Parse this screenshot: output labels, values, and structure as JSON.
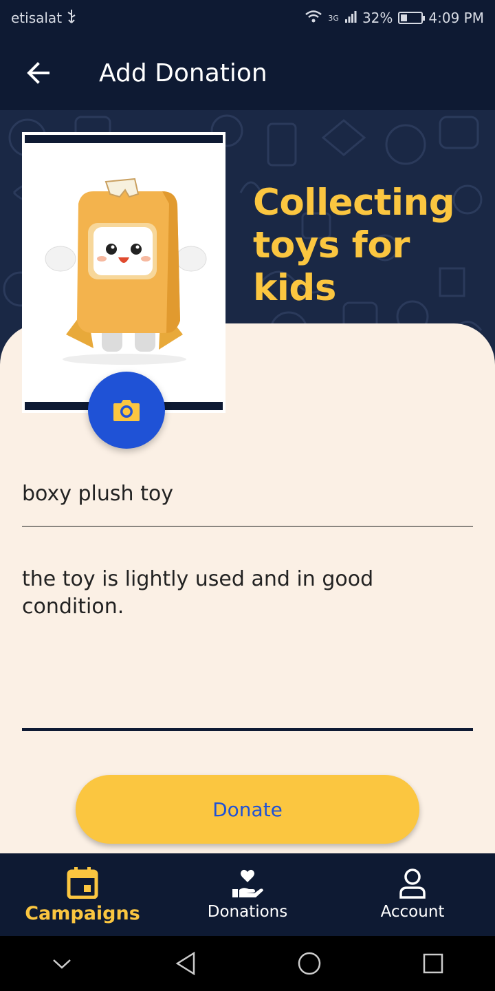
{
  "status_bar": {
    "carrier": "etisalat",
    "network": "3G",
    "battery": "32%",
    "battery_level": 0.32,
    "time": "4:09 PM"
  },
  "app_bar": {
    "title": "Add Donation",
    "back_icon": "arrow-left-icon"
  },
  "hero": {
    "title": "Collecting toys for kids"
  },
  "photo": {
    "camera_icon": "camera-icon"
  },
  "form": {
    "item_name": "boxy plush toy",
    "description": "the toy is lightly used and in good condition."
  },
  "donate_button": {
    "label": "Donate"
  },
  "bottom_nav": {
    "items": [
      {
        "label": "Campaigns",
        "icon": "calendar-icon",
        "active": true
      },
      {
        "label": "Donations",
        "icon": "heart-hand-icon",
        "active": false
      },
      {
        "label": "Account",
        "icon": "person-icon",
        "active": false
      }
    ]
  },
  "colors": {
    "primary_dark": "#0e1a33",
    "accent_yellow": "#fbc640",
    "accent_blue": "#1f52d6",
    "surface": "#fbf0e5"
  }
}
